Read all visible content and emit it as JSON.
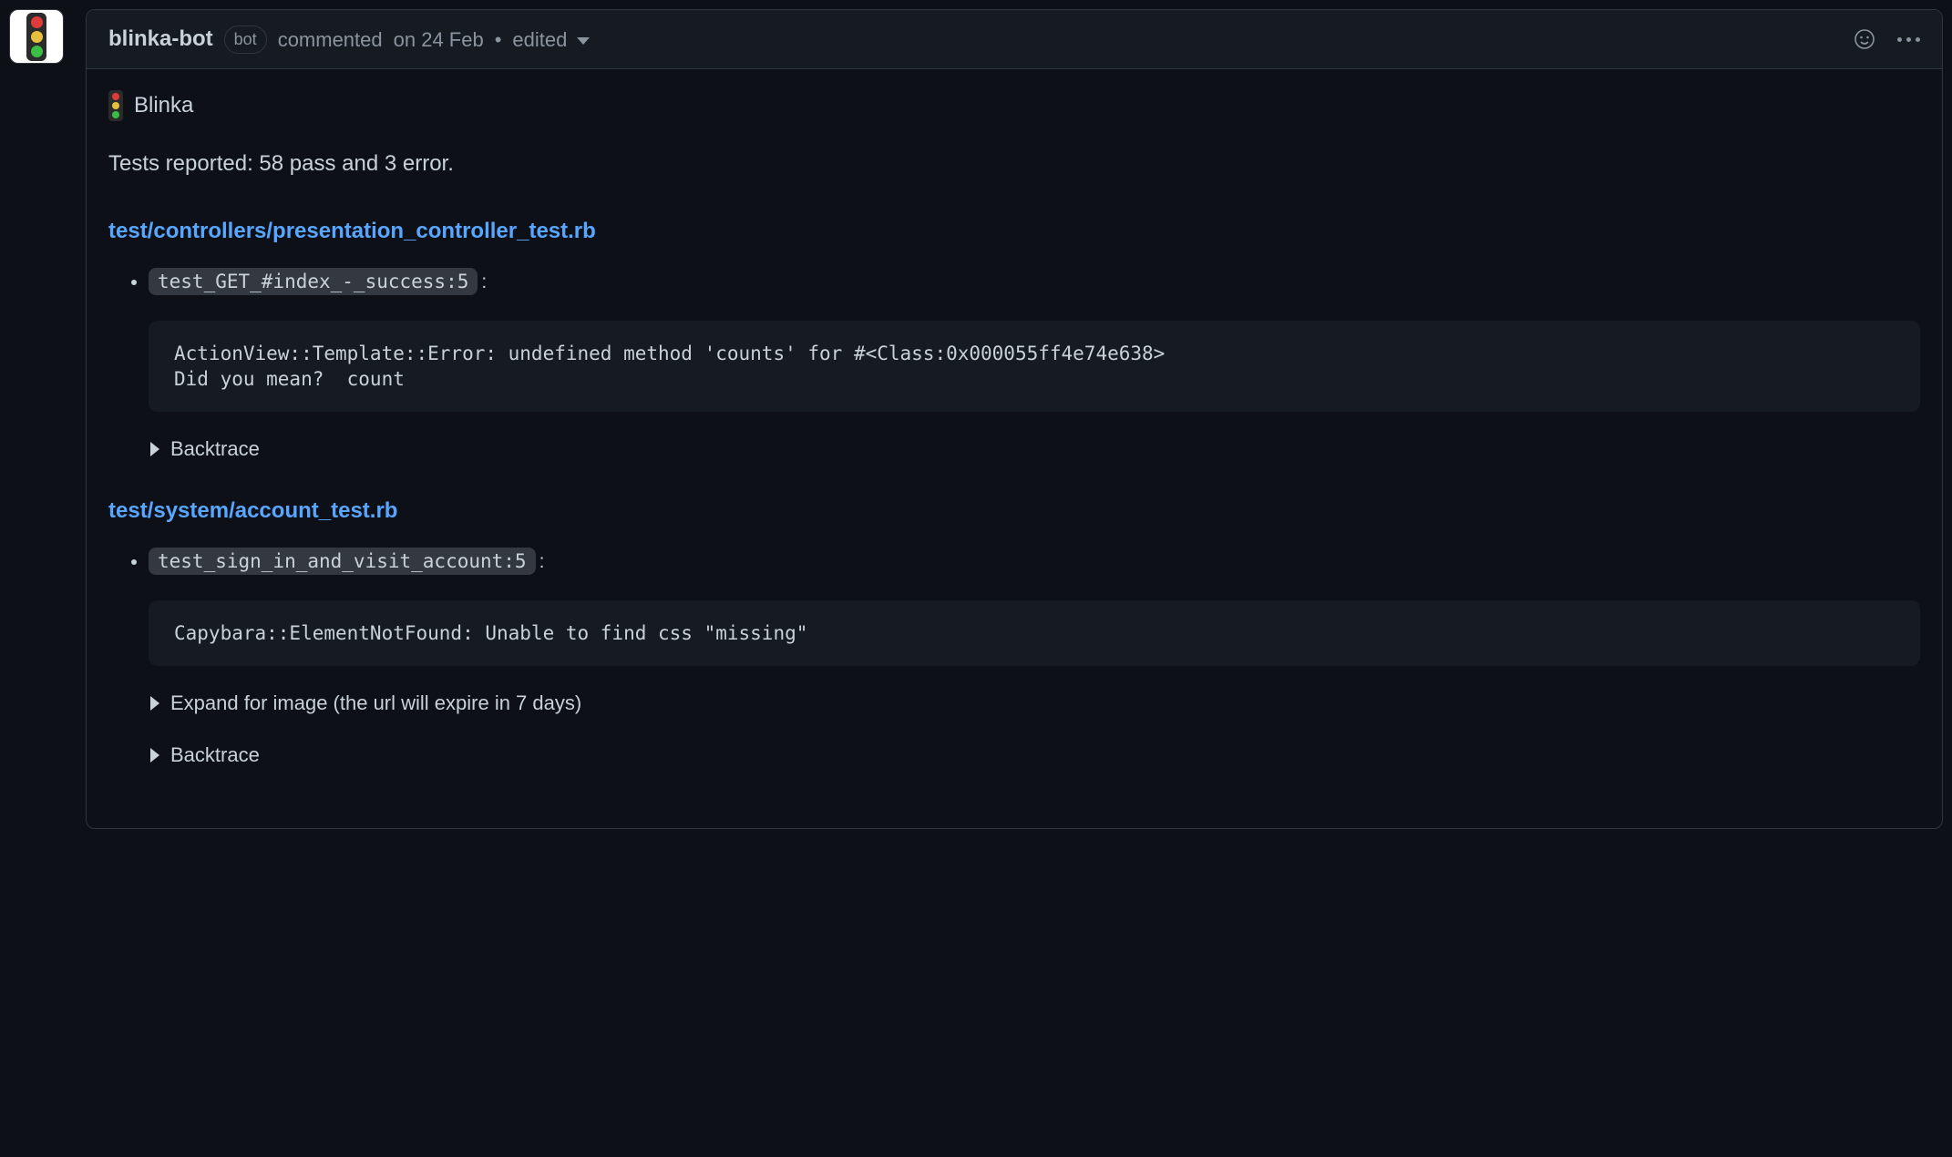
{
  "header": {
    "author": "blinka-bot",
    "bot_badge": "bot",
    "commented_prefix": "commented",
    "date_text": "on 24 Feb",
    "separator": "•",
    "edited_label": "edited"
  },
  "body": {
    "app_name": "Blinka",
    "summary": "Tests reported: 58 pass and 3 error.",
    "sections": [
      {
        "file": "test/controllers/presentation_controller_test.rb",
        "tests": [
          {
            "name_code": "test_GET_#index_-_success:5",
            "trailing": ":",
            "error_block": "ActionView::Template::Error: undefined method 'counts' for #<Class:0x000055ff4e74e638>\nDid you mean?  count",
            "expands": [
              {
                "label": "Backtrace"
              }
            ]
          }
        ]
      },
      {
        "file": "test/system/account_test.rb",
        "tests": [
          {
            "name_code": "test_sign_in_and_visit_account:5",
            "trailing": ":",
            "error_block": "Capybara::ElementNotFound: Unable to find css \"missing\"",
            "expands": [
              {
                "label": "Expand for image (the url will expire in 7 days)"
              },
              {
                "label": "Backtrace"
              }
            ]
          }
        ]
      }
    ]
  }
}
